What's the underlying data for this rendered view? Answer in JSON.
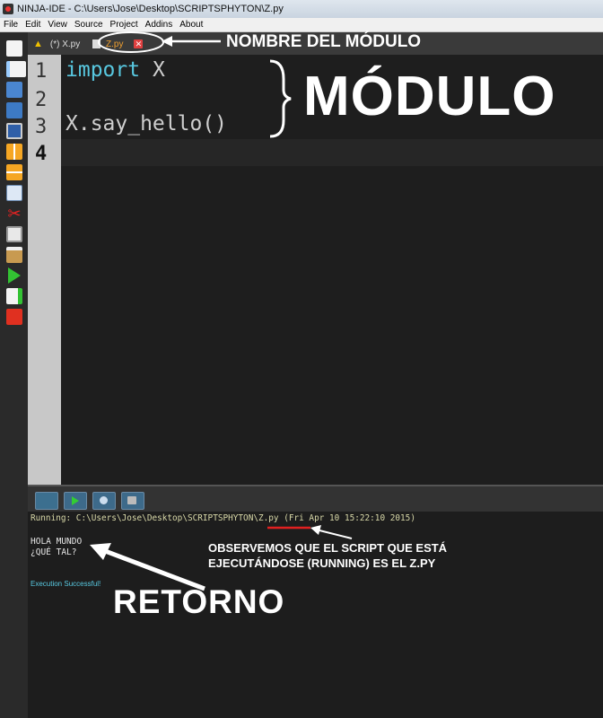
{
  "window": {
    "title": "NINJA-IDE - C:\\Users\\Jose\\Desktop\\SCRIPTSPHYTON\\Z.py"
  },
  "menu": [
    "File",
    "Edit",
    "View",
    "Source",
    "Project",
    "Addins",
    "About"
  ],
  "toolbar_icons": [
    "new-file-icon",
    "new-project-icon",
    "open-file-icon",
    "open-project-icon",
    "save-icon",
    "split-horizontal-icon",
    "split-vertical-icon",
    "find-replace-icon",
    "cut-icon",
    "copy-icon",
    "paste-icon",
    "run-project-icon",
    "run-file-icon",
    "stop-icon"
  ],
  "tabs": [
    {
      "label": "(*) X.py",
      "icon": "warning-icon",
      "active": false
    },
    {
      "label": "Z.py",
      "icon": "close-icon",
      "active": true
    }
  ],
  "editor": {
    "line_numbers": [
      "1",
      "2",
      "3",
      "4"
    ],
    "lines": [
      {
        "kw": "import",
        "rest": " X"
      },
      {
        "kw": "",
        "rest": ""
      },
      {
        "kw": "",
        "rest": "X.say_hello()"
      },
      {
        "kw": "",
        "rest": ""
      }
    ]
  },
  "console": {
    "running_line": "Running: C:\\Users\\Jose\\Desktop\\SCRIPTSPHYTON\\Z.py (Fri Apr 10 15:22:10 2015)",
    "output": [
      "HOLA MUNDO",
      "¿QUÉ TAL?"
    ],
    "status": "Execution Successful!"
  },
  "annotations": {
    "module_name": "NOMBRE DEL MÓDULO",
    "module": "MÓDULO",
    "observe_line1": "OBSERVEMOS QUE EL SCRIPT QUE ESTÁ",
    "observe_line2": "EJECUTÁNDOSE (RUNNING) ES EL Z.PY",
    "return": "RETORNO"
  },
  "colors": {
    "keyword": "#58c8e0",
    "active_tab": "#f0a030",
    "console_text": "#d8d8a8",
    "success": "#58c8e0",
    "underline": "#e02020"
  }
}
